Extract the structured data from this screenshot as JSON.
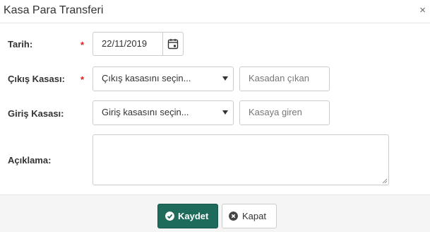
{
  "dialog": {
    "title": "Kasa Para Transferi",
    "close_symbol": "×"
  },
  "form": {
    "required_mark": "*",
    "date": {
      "label": "Tarih:",
      "value": "22/11/2019",
      "icon": "calendar-icon"
    },
    "source": {
      "label": "Çıkış Kasası:",
      "select_text": "Çıkış kasasını seçin...",
      "amount_placeholder": "Kasadan çıkan"
    },
    "target": {
      "label": "Giriş Kasası:",
      "select_text": "Giriş kasasını seçin...",
      "amount_placeholder": "Kasaya giren"
    },
    "description": {
      "label": "Açıklama:",
      "value": ""
    }
  },
  "footer": {
    "save_label": "Kaydet",
    "close_label": "Kapat"
  },
  "colors": {
    "primary": "#1f6b5b",
    "required": "#e01b1b"
  }
}
